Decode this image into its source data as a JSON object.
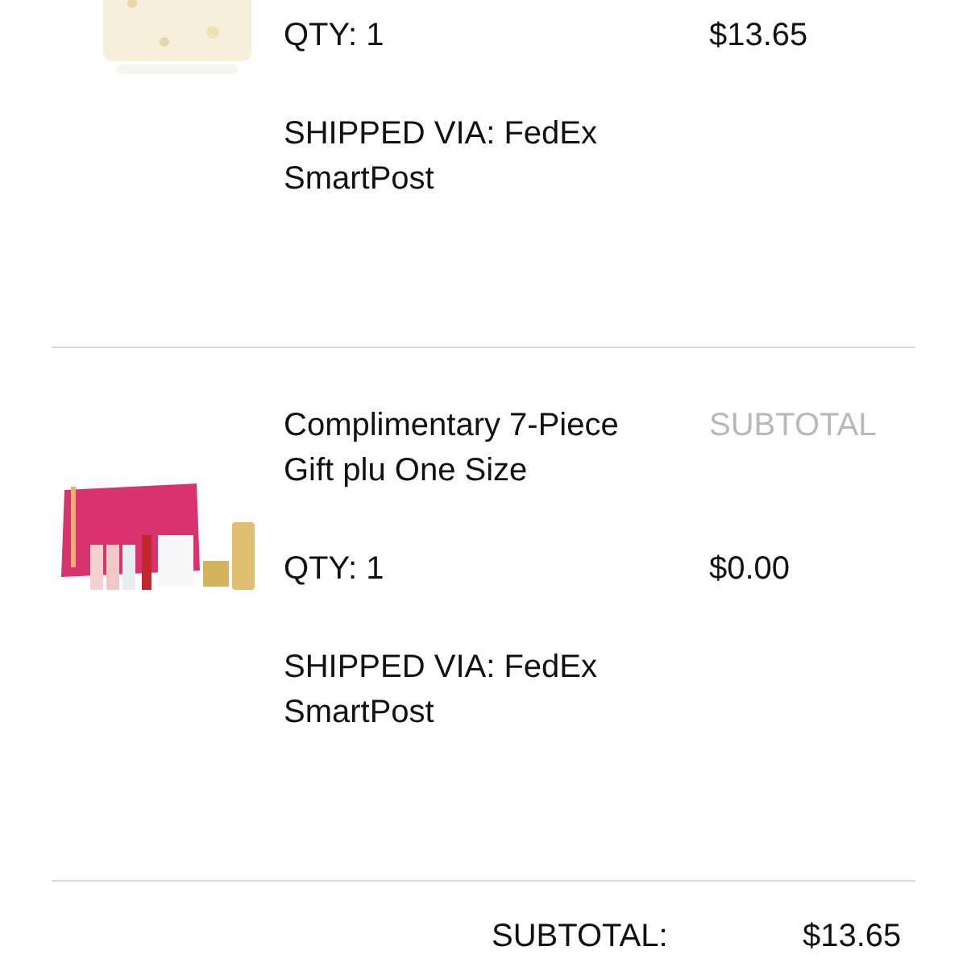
{
  "items": [
    {
      "qty": "QTY: 1",
      "price": "$13.65",
      "shipping": "SHIPPED VIA: FedEx SmartPost"
    },
    {
      "name": "Complimentary 7-Piece Gift plu One Size",
      "price_label": "SUBTOTAL",
      "qty": "QTY: 1",
      "price": "$0.00",
      "shipping": "SHIPPED VIA: FedEx SmartPost"
    }
  ],
  "summary": {
    "label": "SUBTOTAL:",
    "value": "$13.65"
  }
}
